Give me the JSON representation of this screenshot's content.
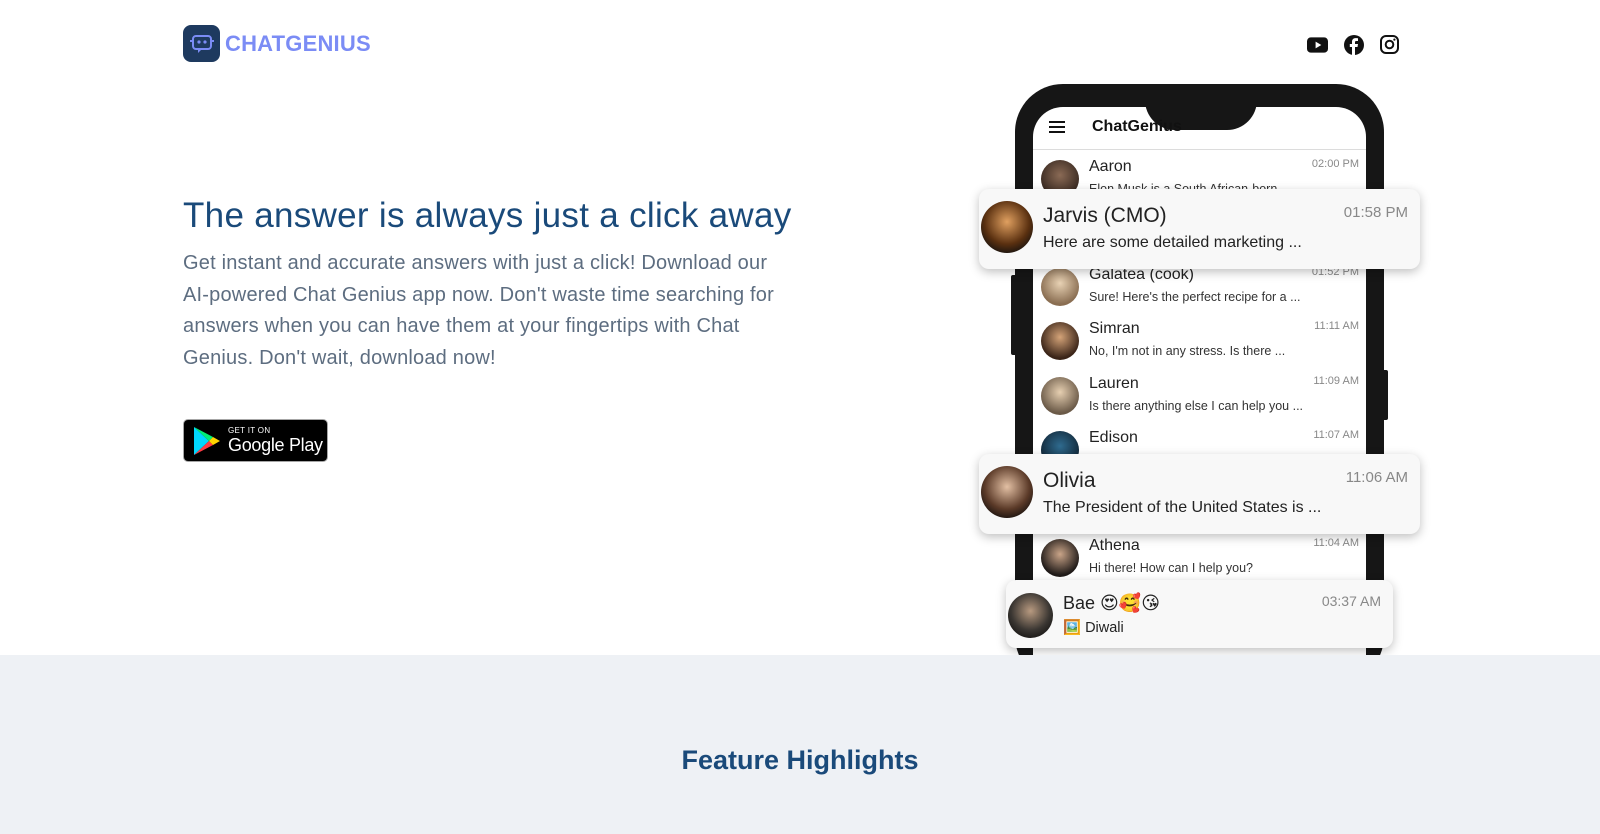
{
  "brand": {
    "name": "CHATGENIUS"
  },
  "header": {
    "socials": [
      "youtube-icon",
      "facebook-icon",
      "instagram-icon"
    ]
  },
  "hero": {
    "title": "The answer is always just a click away",
    "description": "Get instant and accurate answers with just a click! Download our AI-powered Chat Genius app now. Don't waste time searching for answers when you can have them at your fingertips with Chat Genius. Don't wait, download now!",
    "store_badge": {
      "small": "GET IT ON",
      "big": "Google Play"
    }
  },
  "phone": {
    "app_name": "ChatGenius",
    "rows": [
      {
        "name": "Aaron",
        "msg": "Elon Musk is a South African-born ...",
        "time": "02:00 PM"
      },
      {
        "name": "Galatea (cook)",
        "msg": "Sure! Here's the perfect recipe for a ...",
        "time": "01:52 PM"
      },
      {
        "name": "Simran",
        "msg": "No, I'm not in any stress. Is there ...",
        "time": "11:11 AM"
      },
      {
        "name": "Lauren",
        "msg": "Is there anything else I can help you ...",
        "time": "11:09 AM"
      },
      {
        "name": "Edison",
        "msg": "",
        "time": "11:07 AM"
      },
      {
        "name": "Athena",
        "msg": "Hi there! How can I help you?",
        "time": "11:04 AM"
      }
    ],
    "cards": [
      {
        "name": "Jarvis (CMO)",
        "msg": "Here are some detailed marketing ...",
        "time": "01:58 PM"
      },
      {
        "name": "Olivia",
        "msg": "The President of the United States is ...",
        "time": "11:06 AM"
      },
      {
        "name": "Bae 😍🥰😘",
        "msg": "🖼️ Diwali",
        "time": "03:37 AM"
      }
    ]
  },
  "features": {
    "title": "Feature Highlights"
  }
}
